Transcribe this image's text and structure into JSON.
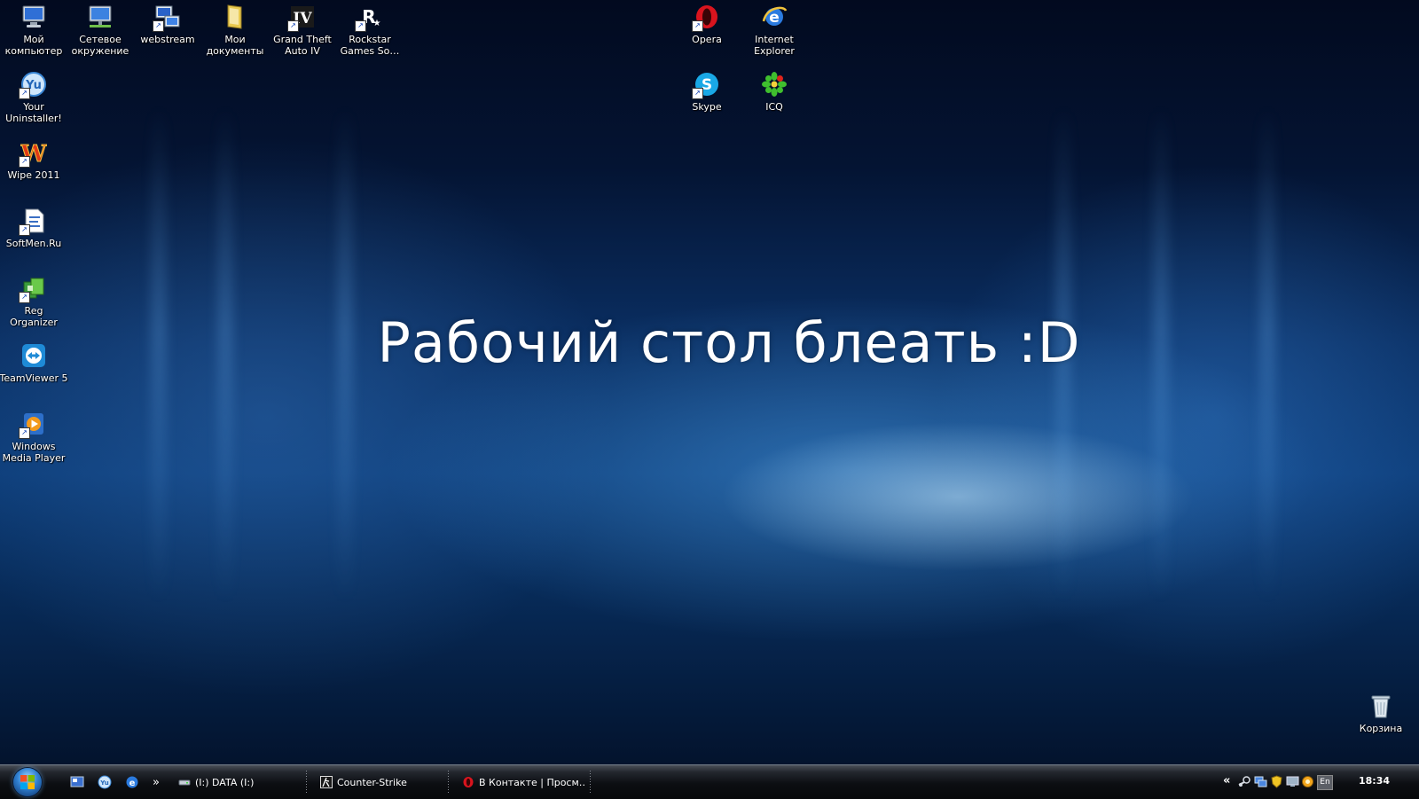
{
  "desktop": {
    "headline": "Рабочий стол блеать :D",
    "icons": {
      "my_computer": "Мой\nкомпьютер",
      "network": "Сетевое\nокружение",
      "webstream": "webstream",
      "my_documents": "Мои\nдокументы",
      "gta4": "Grand Theft\nAuto IV",
      "rockstar": "Rockstar\nGames So…",
      "opera": "Opera",
      "ie": "Internet\nExplorer",
      "your_uninstaller": "Your\nUninstaller!",
      "skype": "Skype",
      "icq": "ICQ",
      "wipe": "Wipe 2011",
      "softmen": "SoftMen.Ru",
      "reg_organizer": "Reg Organizer",
      "teamviewer": "TeamViewer 5",
      "wmp": "Windows\nMedia Player",
      "recycle_bin": "Корзина"
    }
  },
  "taskbar": {
    "quicklaunch_more": "»",
    "tasks": [
      "(I:) DATA (I:)",
      "Counter-Strike",
      "В Контакте | Просм…"
    ],
    "tray_collapse": "«",
    "language": "En",
    "clock": "18:34"
  },
  "colors": {
    "desktop_dark": "#041433",
    "desktop_glow": "#0c3c78",
    "taskbar": "#0c0e12"
  }
}
